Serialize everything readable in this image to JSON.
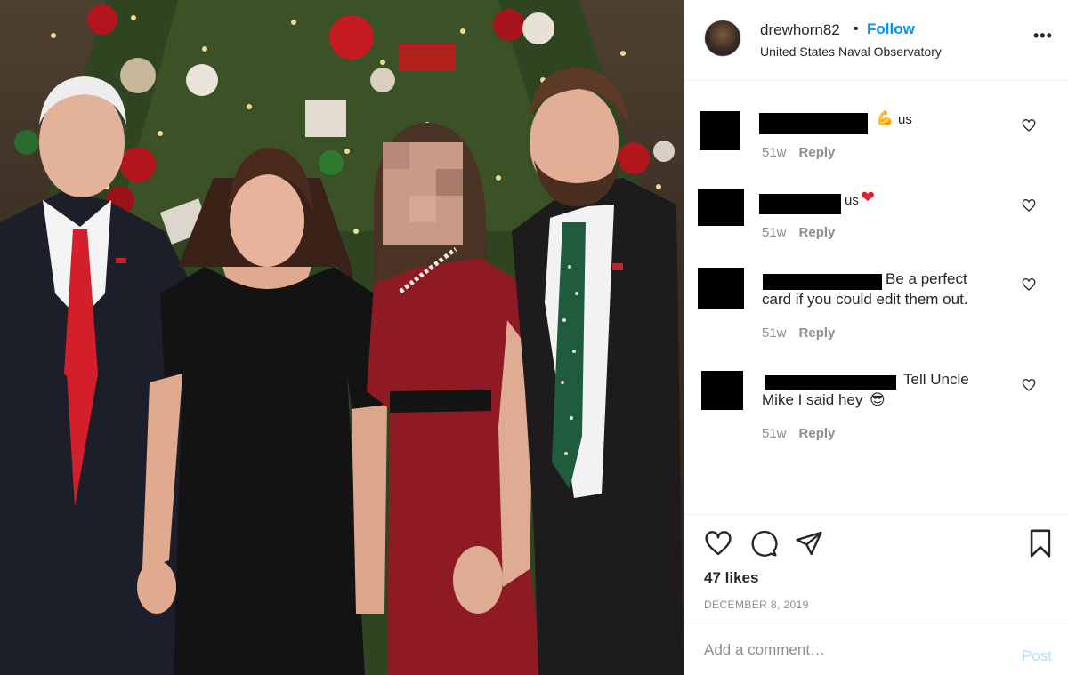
{
  "post": {
    "username": "drewhorn82",
    "separator": "•",
    "follow_label": "Follow",
    "location": "United States Naval Observatory",
    "more_label": "•••",
    "likes": "47 likes",
    "date": "DECEMBER 8, 2019"
  },
  "comments": [
    {
      "text": "us",
      "emoji": "💪",
      "time": "51w",
      "reply_label": "Reply"
    },
    {
      "text": "us",
      "emoji": "❤",
      "time": "51w",
      "reply_label": "Reply"
    },
    {
      "text_line1": "Be a perfect",
      "text_line2": "card if you could edit them out.",
      "time": "51w",
      "reply_label": "Reply"
    },
    {
      "text_line1": "Tell Uncle",
      "text_line2": "Mike I said hey",
      "emoji": "😎",
      "time": "51w",
      "reply_label": "Reply"
    }
  ],
  "composer": {
    "placeholder": "Add a comment…",
    "post_label": "Post"
  },
  "icons": {
    "like": "heart-icon",
    "comment": "comment-bubble-icon",
    "share": "paper-plane-icon",
    "save": "bookmark-icon"
  },
  "colors": {
    "follow": "#0095f6",
    "post_disabled": "#b2dffc",
    "muted": "#8e8e8e"
  }
}
